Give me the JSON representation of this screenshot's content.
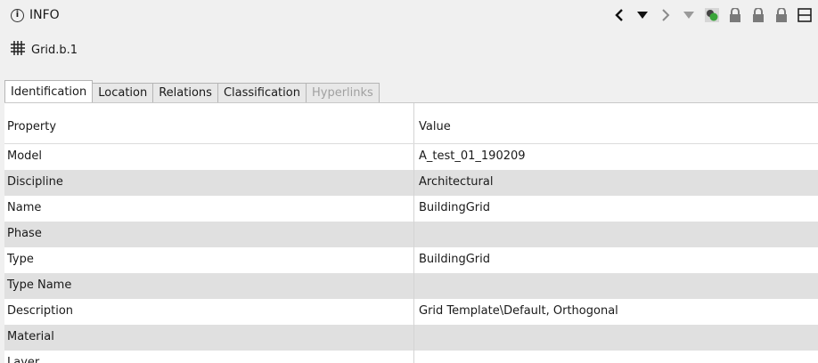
{
  "panel": {
    "title": "INFO",
    "info_glyph": "i",
    "icon": "info-circle-icon"
  },
  "toolbar": {
    "icons": [
      "back-arrow-icon",
      "back-dropdown-icon",
      "forward-arrow-icon",
      "forward-dropdown-icon",
      "selection-tool-icon",
      "lock-icon",
      "lock-icon",
      "lock-icon",
      "window-icon"
    ]
  },
  "element": {
    "name": "Grid.b.1",
    "icon": "grid-icon"
  },
  "tabs": [
    {
      "label": "Identification",
      "active": true,
      "enabled": true
    },
    {
      "label": "Location",
      "active": false,
      "enabled": true
    },
    {
      "label": "Relations",
      "active": false,
      "enabled": true
    },
    {
      "label": "Classification",
      "active": false,
      "enabled": true
    },
    {
      "label": "Hyperlinks",
      "active": false,
      "enabled": false
    }
  ],
  "table": {
    "columns": [
      "Property",
      "Value"
    ],
    "rows": [
      {
        "property": "Model",
        "value": "A_test_01_190209"
      },
      {
        "property": "Discipline",
        "value": "Architectural"
      },
      {
        "property": "Name",
        "value": "BuildingGrid"
      },
      {
        "property": "Phase",
        "value": ""
      },
      {
        "property": "Type",
        "value": "BuildingGrid"
      },
      {
        "property": "Type Name",
        "value": ""
      },
      {
        "property": "Description",
        "value": "Grid Template\\Default, Orthogonal"
      },
      {
        "property": "Material",
        "value": ""
      },
      {
        "property": "Layer",
        "value": ""
      }
    ]
  },
  "colors": {
    "panel_bg": "#f0f0f0",
    "row_alt": "#e0e0e0",
    "icon_green": "#3aa53a",
    "icon_gray": "#6e6e6e"
  }
}
